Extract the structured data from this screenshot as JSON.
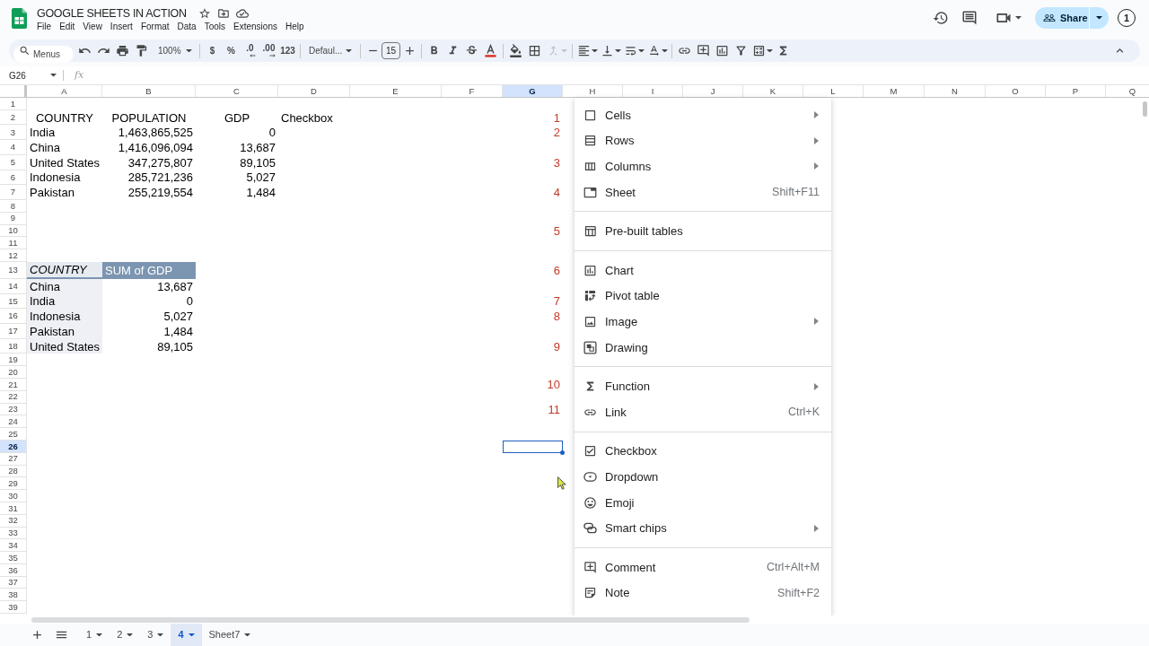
{
  "document": {
    "title": "GOOGLE SHEETS IN ACTION"
  },
  "menu_bar": [
    "File",
    "Edit",
    "View",
    "Insert",
    "Format",
    "Data",
    "Tools",
    "Extensions",
    "Help"
  ],
  "header": {
    "share_label": "Share",
    "account_badge": "1"
  },
  "toolbar": {
    "search_placeholder": "Menus",
    "zoom": "100%",
    "number_formats": [
      {
        "label": "$",
        "kind": "plain"
      },
      {
        "label": "%",
        "kind": "plain"
      },
      {
        "label": ".0",
        "kind": "decrease"
      },
      {
        "label": ".00",
        "kind": "increase"
      },
      {
        "label": "123",
        "kind": "plain"
      }
    ],
    "font": "Defaul...",
    "font_size": "15",
    "merge": {
      "disabled": true
    }
  },
  "formula_bar": {
    "cell_ref": "G26",
    "fx_label": "fx"
  },
  "columns": [
    {
      "label": "A",
      "selected": false
    },
    {
      "label": "B",
      "selected": false
    },
    {
      "label": "C",
      "selected": false
    },
    {
      "label": "D",
      "selected": false
    },
    {
      "label": "E",
      "selected": false
    },
    {
      "label": "F",
      "selected": false
    },
    {
      "label": "G",
      "selected": true
    },
    {
      "label": "H",
      "selected": false
    },
    {
      "label": "I",
      "selected": false
    },
    {
      "label": "J",
      "selected": false
    },
    {
      "label": "K",
      "selected": false
    },
    {
      "label": "L",
      "selected": false
    },
    {
      "label": "M",
      "selected": false
    },
    {
      "label": "N",
      "selected": false
    },
    {
      "label": "O",
      "selected": false
    },
    {
      "label": "P",
      "selected": false
    },
    {
      "label": "Q",
      "selected": false
    }
  ],
  "rows": [
    {
      "label": "1",
      "selected": false
    },
    {
      "label": "2",
      "selected": false,
      "cells": [
        {
          "text": "COUNTRY",
          "kind": "heading"
        },
        {
          "text": "POPULATION",
          "kind": "heading"
        },
        {
          "text": "GDP",
          "kind": "heading"
        },
        {
          "text": "Checkbox",
          "kind": "text"
        }
      ],
      "marker": "1"
    },
    {
      "label": "3",
      "selected": false,
      "cells": [
        {
          "text": "India",
          "kind": "text"
        },
        {
          "text": "1,463,865,525",
          "kind": "number"
        },
        {
          "text": "0",
          "kind": "number"
        }
      ],
      "marker": "2"
    },
    {
      "label": "4",
      "selected": false,
      "cells": [
        {
          "text": "China",
          "kind": "text"
        },
        {
          "text": "1,416,096,094",
          "kind": "number"
        },
        {
          "text": "13,687",
          "kind": "number"
        }
      ]
    },
    {
      "label": "5",
      "selected": false,
      "cells": [
        {
          "text": "United States",
          "kind": "text"
        },
        {
          "text": "347,275,807",
          "kind": "number"
        },
        {
          "text": "89,105",
          "kind": "number"
        }
      ],
      "marker": "3"
    },
    {
      "label": "6",
      "selected": false,
      "cells": [
        {
          "text": "Indonesia",
          "kind": "text"
        },
        {
          "text": "285,721,236",
          "kind": "number"
        },
        {
          "text": "5,027",
          "kind": "number"
        }
      ]
    },
    {
      "label": "7",
      "selected": false,
      "cells": [
        {
          "text": "Pakistan",
          "kind": "text"
        },
        {
          "text": "255,219,554",
          "kind": "number"
        },
        {
          "text": "1,484",
          "kind": "number"
        }
      ],
      "marker": "4"
    },
    {
      "label": "8",
      "selected": false
    },
    {
      "label": "9",
      "selected": false
    },
    {
      "label": "10",
      "selected": false,
      "marker": "5"
    },
    {
      "label": "11",
      "selected": false
    },
    {
      "label": "12",
      "selected": false
    },
    {
      "label": "13",
      "selected": false,
      "cells": [
        {
          "text": "COUNTRY",
          "kind": "pivot_heading"
        },
        {
          "text": "SUM of GDP",
          "kind": "pivot_value_heading"
        }
      ],
      "marker": "6"
    },
    {
      "label": "14",
      "selected": false,
      "cells": [
        {
          "text": "China",
          "kind": "pivot_label"
        },
        {
          "text": "13,687",
          "kind": "number"
        }
      ]
    },
    {
      "label": "15",
      "selected": false,
      "cells": [
        {
          "text": "India",
          "kind": "pivot_label"
        },
        {
          "text": "0",
          "kind": "number"
        }
      ],
      "marker": "7"
    },
    {
      "label": "16",
      "selected": false,
      "cells": [
        {
          "text": "Indonesia",
          "kind": "pivot_label"
        },
        {
          "text": "5,027",
          "kind": "number"
        }
      ],
      "marker": "8"
    },
    {
      "label": "17",
      "selected": false,
      "cells": [
        {
          "text": "Pakistan",
          "kind": "pivot_label"
        },
        {
          "text": "1,484",
          "kind": "number"
        }
      ]
    },
    {
      "label": "18",
      "selected": false,
      "cells": [
        {
          "text": "United States",
          "kind": "pivot_label"
        },
        {
          "text": "89,105",
          "kind": "number"
        }
      ],
      "marker": "9"
    },
    {
      "label": "19",
      "selected": false
    },
    {
      "label": "20",
      "selected": false
    },
    {
      "label": "21",
      "selected": false,
      "marker": "10"
    },
    {
      "label": "22",
      "selected": false
    },
    {
      "label": "23",
      "selected": false,
      "marker": "11"
    },
    {
      "label": "24",
      "selected": false
    },
    {
      "label": "25",
      "selected": false
    },
    {
      "label": "26",
      "selected": true
    },
    {
      "label": "27",
      "selected": false
    },
    {
      "label": "28",
      "selected": false
    },
    {
      "label": "29",
      "selected": false
    },
    {
      "label": "30",
      "selected": false
    },
    {
      "label": "31",
      "selected": false
    },
    {
      "label": "32",
      "selected": false
    },
    {
      "label": "33",
      "selected": false
    },
    {
      "label": "34",
      "selected": false
    },
    {
      "label": "35",
      "selected": false
    },
    {
      "label": "36",
      "selected": false
    },
    {
      "label": "37",
      "selected": false
    },
    {
      "label": "38",
      "selected": false
    },
    {
      "label": "39",
      "selected": false
    }
  ],
  "insert_menu": {
    "sections": [
      [
        {
          "label": "Cells",
          "submenu": true
        },
        {
          "label": "Rows",
          "submenu": true
        },
        {
          "label": "Columns",
          "submenu": true
        },
        {
          "label": "Sheet",
          "submenu": false,
          "shortcut": "Shift+F11"
        }
      ],
      [
        {
          "label": "Pre-built tables",
          "submenu": false
        }
      ],
      [
        {
          "label": "Chart",
          "submenu": false
        },
        {
          "label": "Pivot table",
          "submenu": false
        },
        {
          "label": "Image",
          "submenu": true
        },
        {
          "label": "Drawing",
          "submenu": false
        }
      ],
      [
        {
          "label": "Function",
          "submenu": true
        },
        {
          "label": "Link",
          "submenu": false,
          "shortcut": "Ctrl+K"
        }
      ],
      [
        {
          "label": "Checkbox",
          "submenu": false
        },
        {
          "label": "Dropdown",
          "submenu": false
        },
        {
          "label": "Emoji",
          "submenu": false
        },
        {
          "label": "Smart chips",
          "submenu": true
        }
      ],
      [
        {
          "label": "Comment",
          "submenu": false,
          "shortcut": "Ctrl+Alt+M"
        },
        {
          "label": "Note",
          "submenu": false,
          "shortcut": "Shift+F2"
        }
      ]
    ]
  },
  "sheet_tabs": [
    {
      "label": "1",
      "selected": false
    },
    {
      "label": "2",
      "selected": false
    },
    {
      "label": "3",
      "selected": false
    },
    {
      "label": "4",
      "selected": true
    },
    {
      "label": "Sheet7",
      "selected": false
    }
  ]
}
